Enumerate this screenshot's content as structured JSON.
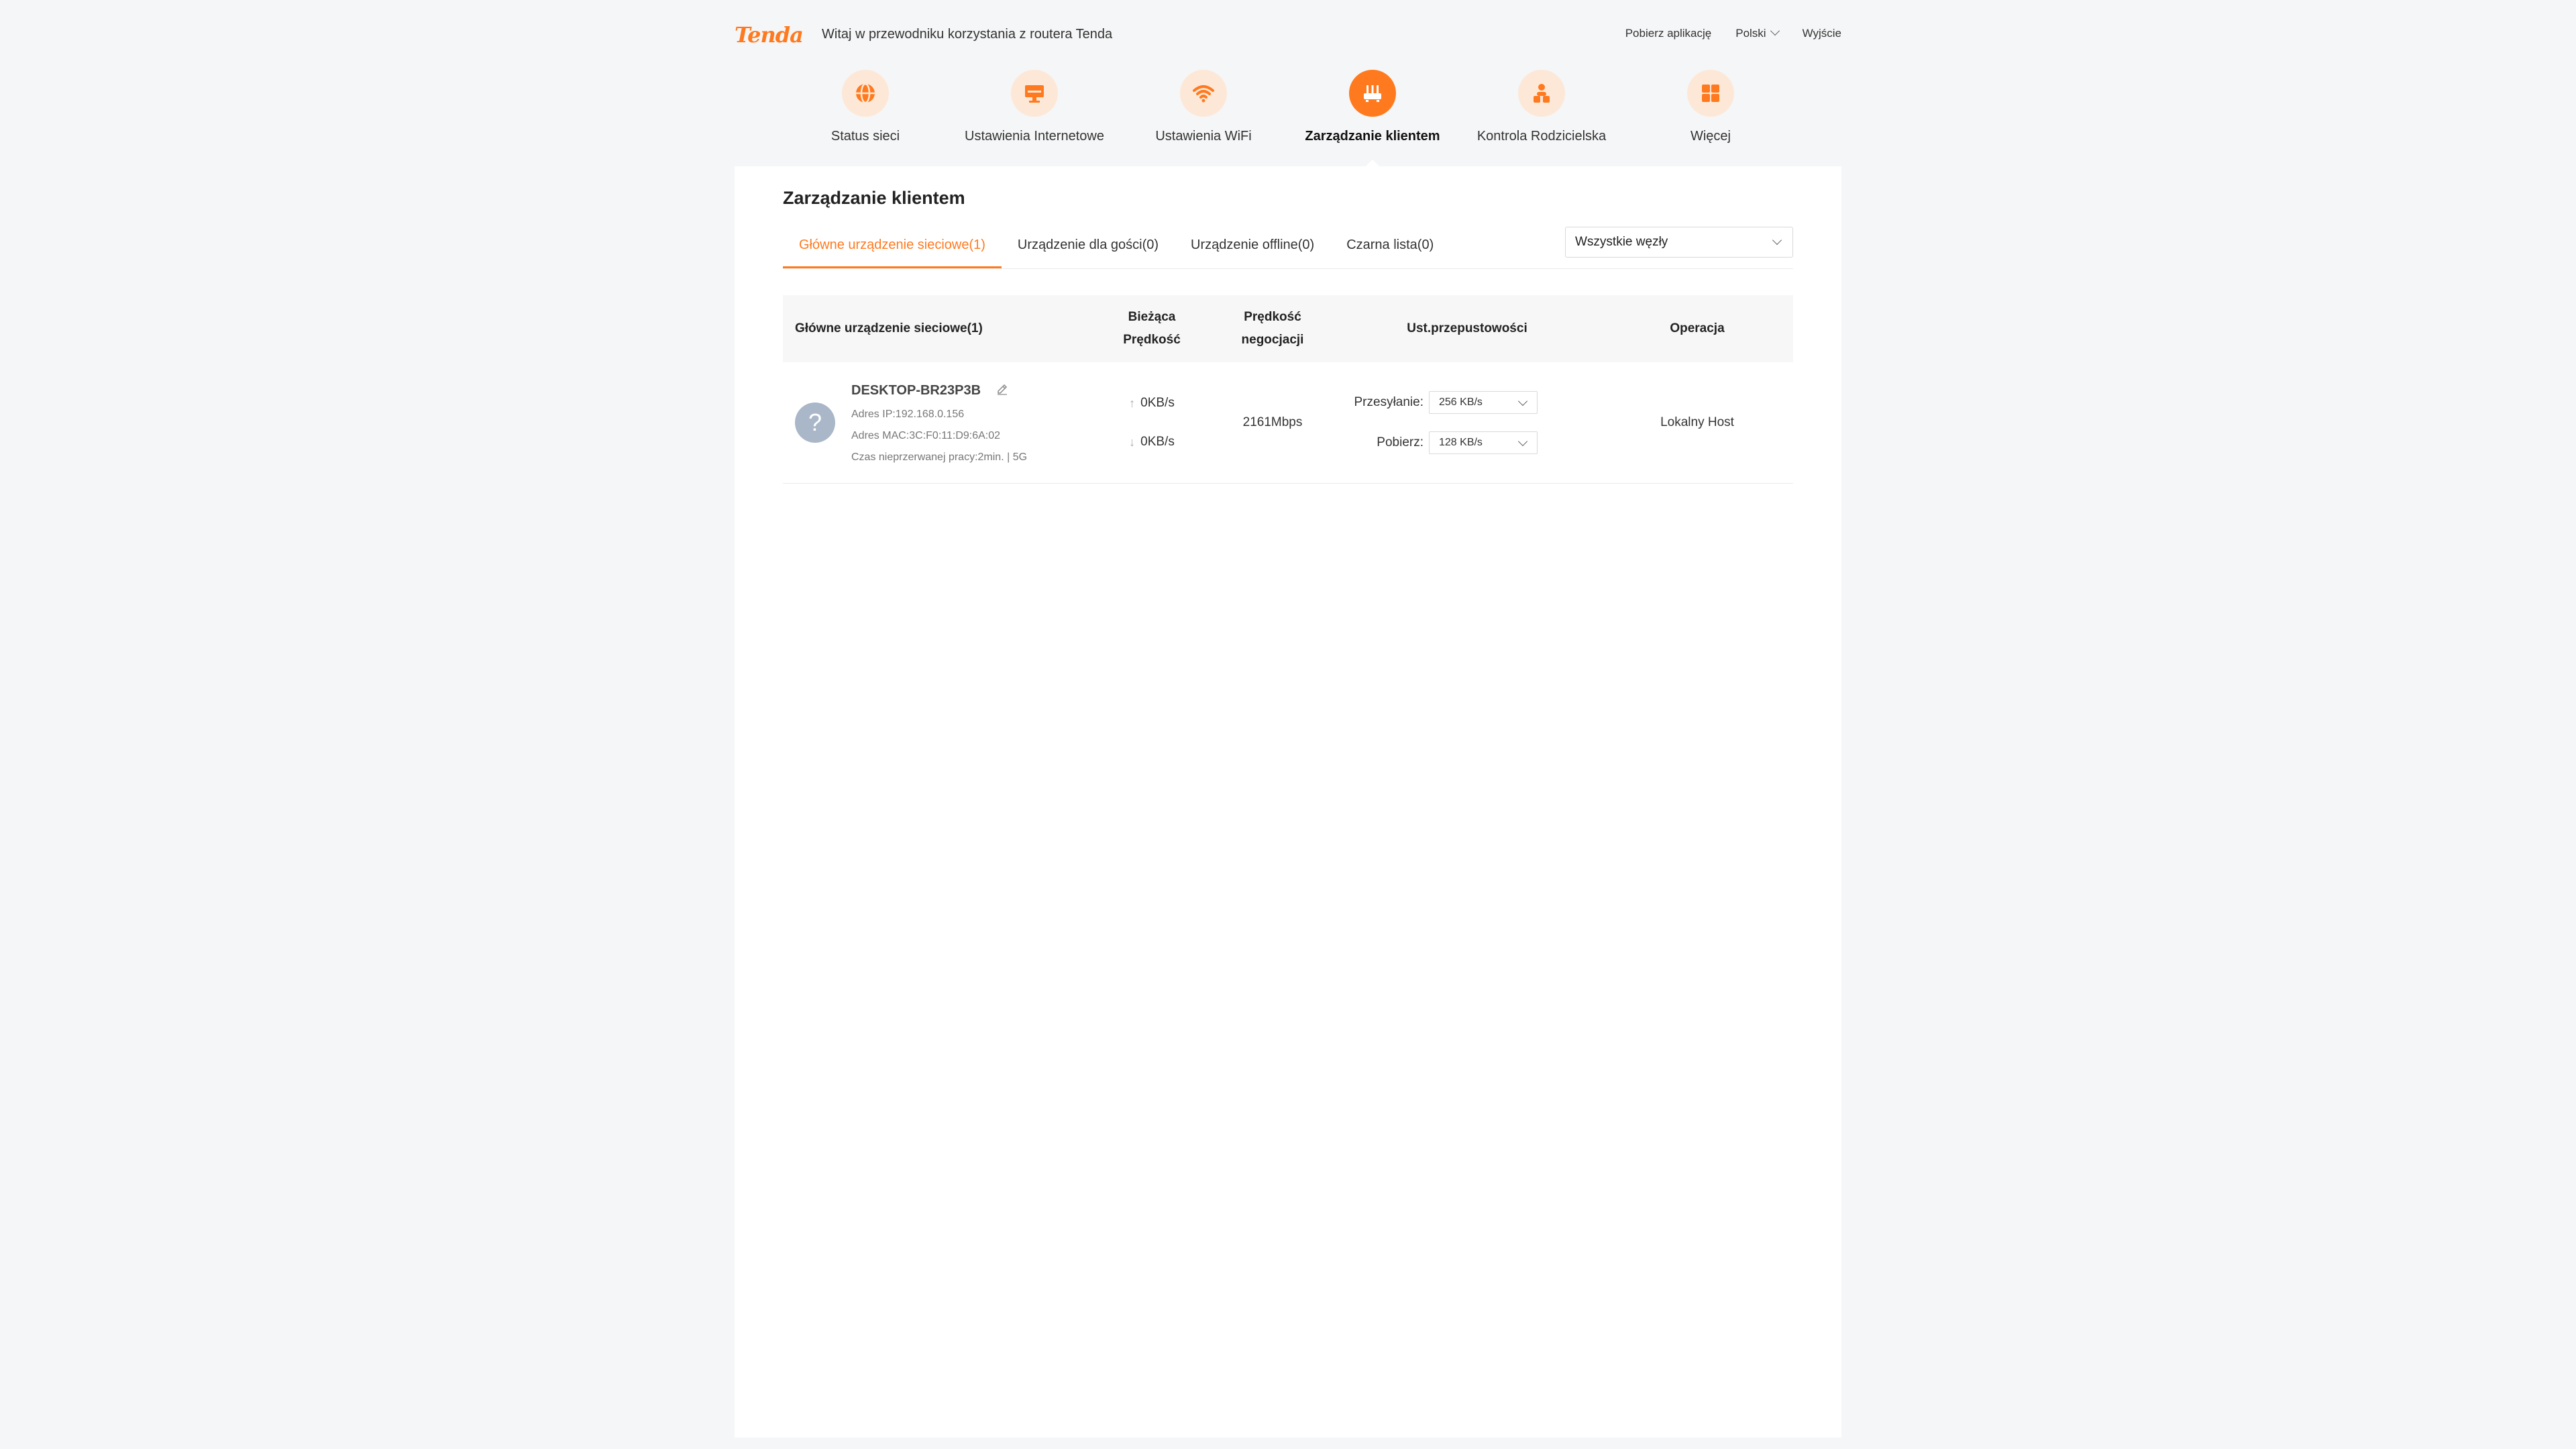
{
  "header": {
    "logo": "Tenda",
    "welcome": "Witaj w przewodniku korzystania z routera Tenda",
    "download_app": "Pobierz aplikację",
    "language": "Polski",
    "logout": "Wyjście"
  },
  "nav": [
    {
      "label": "Status sieci",
      "icon": "globe-icon"
    },
    {
      "label": "Ustawienia Internetowe",
      "icon": "monitor-icon"
    },
    {
      "label": "Ustawienia WiFi",
      "icon": "wifi-icon"
    },
    {
      "label": "Zarządzanie klientem",
      "icon": "router-icon",
      "active": true
    },
    {
      "label": "Kontrola Rodzicielska",
      "icon": "parental-icon"
    },
    {
      "label": "Więcej",
      "icon": "grid-icon"
    }
  ],
  "panel": {
    "title": "Zarządzanie klientem",
    "tabs": [
      {
        "label": "Główne urządzenie sieciowe(1)",
        "active": true
      },
      {
        "label": "Urządzenie dla gości(0)"
      },
      {
        "label": "Urządzenie offline(0)"
      },
      {
        "label": "Czarna lista(0)"
      }
    ],
    "node_filter": "Wszystkie węzły"
  },
  "table": {
    "headers": {
      "device": "Główne urządzenie sieciowe(1)",
      "speed_1": "Bieżąca",
      "speed_2": "Prędkość",
      "neg_1": "Prędkość",
      "neg_2": "negocjacji",
      "bandwidth": "Ust.przepustowości",
      "operation": "Operacja"
    },
    "rows": [
      {
        "name": "DESKTOP-BR23P3B",
        "ip": "Adres IP:192.168.0.156",
        "mac": "Adres MAC:3C:F0:11:D9:6A:02",
        "uptime": "Czas nieprzerwanej pracy:2min. | 5G",
        "up_speed": "0KB/s",
        "down_speed": "0KB/s",
        "negotiated": "2161Mbps",
        "upload_label": "Przesyłanie:",
        "upload_limit": "256 KB/s",
        "download_label": "Pobierz:",
        "download_limit": "128 KB/s",
        "operation": "Lokalny Host"
      }
    ]
  },
  "colors": {
    "accent": "#ff7a1f",
    "accent_light": "#fde8d8",
    "avatar": "#a9b7c9"
  }
}
